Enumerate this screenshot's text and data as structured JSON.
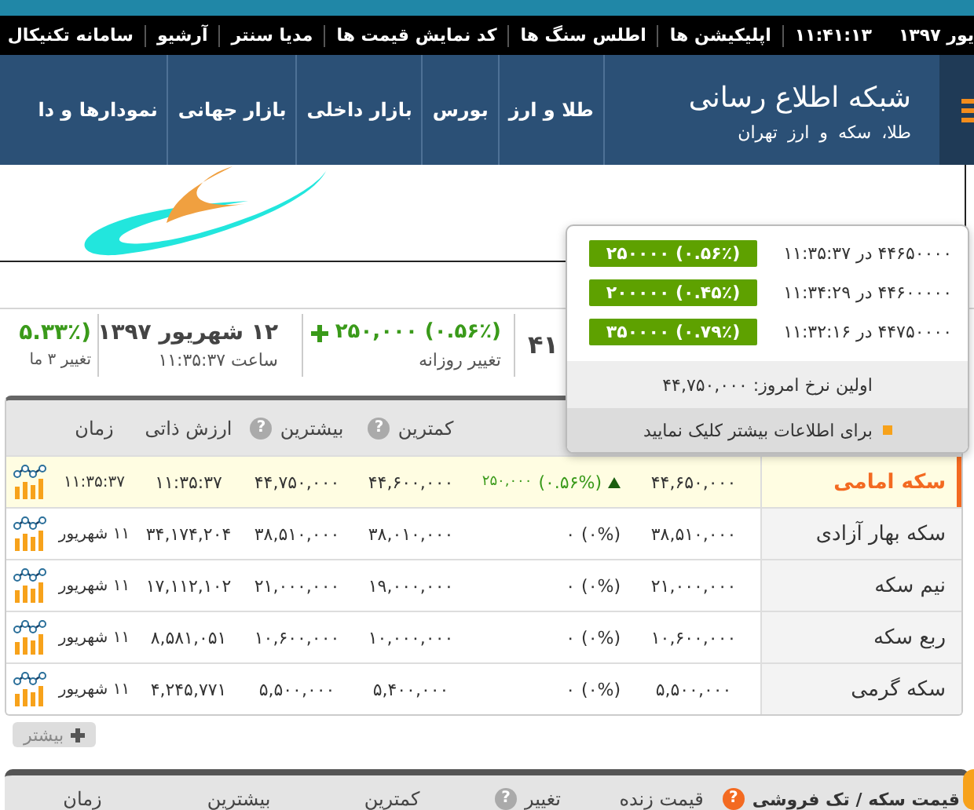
{
  "top_bar": {
    "items": [
      {
        "kind": "date",
        "text": "یور ۱۳۹۷"
      },
      {
        "kind": "clock",
        "text": "۱۱:۴۱:۱۳"
      },
      {
        "kind": "link",
        "text": "اپلیکیشن ها"
      },
      {
        "kind": "link",
        "text": "اطلس سنگ ها"
      },
      {
        "kind": "link",
        "text": "کد نمایش قیمت ها"
      },
      {
        "kind": "link",
        "text": "مدیا سنتر"
      },
      {
        "kind": "link",
        "text": "آرشیو"
      },
      {
        "kind": "link",
        "text": "سامانه تکنیکال"
      }
    ]
  },
  "header": {
    "site_title": "شبکه اطلاع رسانی",
    "site_subtitle": "طلا، سکه و ارز تهران",
    "nav": [
      "طلا و ارز",
      "بورس",
      "بازار داخلی",
      "بازار جهانی",
      "نمودارها و دا"
    ]
  },
  "summary": [
    {
      "value": "۴۱",
      "rising": false,
      "sign_icon": false
    },
    {
      "value": "۲۵۰,۰۰۰ (۰.۵۶٪)",
      "caption": "تغییر روزانه",
      "rising": true,
      "sign_icon": true
    },
    {
      "value": "۱۲ شهریور ۱۳۹۷",
      "caption": "ساعت ۱۱:۳۵:۳۷",
      "rising": false,
      "sign_icon": false
    },
    {
      "value": "۵.۳۳٪)",
      "caption": "تغییر ۳ ما",
      "rising": true,
      "sign_icon": false
    }
  ],
  "popup": {
    "rows": [
      {
        "text": "۴۴۶۵۰۰۰۰ در ۱۱:۳۵:۳۷",
        "badge": "۲۵۰۰۰۰ (۰.۵۶٪)"
      },
      {
        "text": "۴۴۶۰۰۰۰۰ در ۱۱:۳۴:۲۹",
        "badge": "۲۰۰۰۰۰ (۰.۴۵٪)"
      },
      {
        "text": "۴۴۷۵۰۰۰۰ در ۱۱:۳۲:۱۶",
        "badge": "۳۵۰۰۰۰ (۰.۷۹٪)"
      }
    ],
    "first_rate": "اولین نرخ امروز: ۴۴,۷۵۰,۰۰۰",
    "more_link": "برای اطلاعات بیشتر کلیک نمایید"
  },
  "table": {
    "columns": [
      {
        "label": "کمترین",
        "help": "?"
      },
      {
        "label": "بیشترین",
        "help": "?"
      },
      {
        "label": "ارزش ذاتی"
      },
      {
        "label": "زمان"
      }
    ],
    "rows": [
      {
        "name": "سکه امامی",
        "selected": true,
        "price": "۴۴,۶۵۰,۰۰۰",
        "rising": true,
        "change_percent": "(۰.۵۶%)",
        "change": "۲۵۰,۰۰۰",
        "low": "۴۴,۶۰۰,۰۰۰",
        "high": "۴۴,۷۵۰,۰۰۰",
        "value": "۱۱:۳۵:۳۷",
        "time": "۱۱:۳۵:۳۷"
      },
      {
        "name": "سکه بهار آزادی",
        "selected": false,
        "price": "۳۸,۵۱۰,۰۰۰",
        "rising": false,
        "change_percent": "(۰%)",
        "change": "۰",
        "low": "۳۸,۰۱۰,۰۰۰",
        "high": "۳۸,۵۱۰,۰۰۰",
        "value": "۳۴,۱۷۴,۲۰۴",
        "time": "۱۱ شهریور"
      },
      {
        "name": "نیم سکه",
        "selected": false,
        "price": "۲۱,۰۰۰,۰۰۰",
        "rising": false,
        "change_percent": "(۰%)",
        "change": "۰",
        "low": "۱۹,۰۰۰,۰۰۰",
        "high": "۲۱,۰۰۰,۰۰۰",
        "value": "۱۷,۱۱۲,۱۰۲",
        "time": "۱۱ شهریور"
      },
      {
        "name": "ربع سکه",
        "selected": false,
        "price": "۱۰,۶۰۰,۰۰۰",
        "rising": false,
        "change_percent": "(۰%)",
        "change": "۰",
        "low": "۱۰,۰۰۰,۰۰۰",
        "high": "۱۰,۶۰۰,۰۰۰",
        "value": "۸,۵۸۱,۰۵۱",
        "time": "۱۱ شهریور"
      },
      {
        "name": "سکه گرمی",
        "selected": false,
        "price": "۵,۵۰۰,۰۰۰",
        "rising": false,
        "change_percent": "(۰%)",
        "change": "۰",
        "low": "۵,۴۰۰,۰۰۰",
        "high": "۵,۵۰۰,۰۰۰",
        "value": "۴,۲۴۵,۷۷۱",
        "time": "۱۱ شهریور"
      }
    ],
    "more_button": "بیشتر"
  },
  "section": {
    "columns": [
      {
        "label": "قیمت سکه / تک فروشی",
        "kind": "title",
        "help": "?"
      },
      {
        "label": "قیمت زنده",
        "kind": "plain"
      },
      {
        "label": "تغییر",
        "kind": "plain",
        "help": "?"
      },
      {
        "label": "کمترین",
        "kind": "plain"
      },
      {
        "label": "بیشترین",
        "kind": "plain"
      },
      {
        "label": "زمان",
        "kind": "plain"
      }
    ]
  }
}
